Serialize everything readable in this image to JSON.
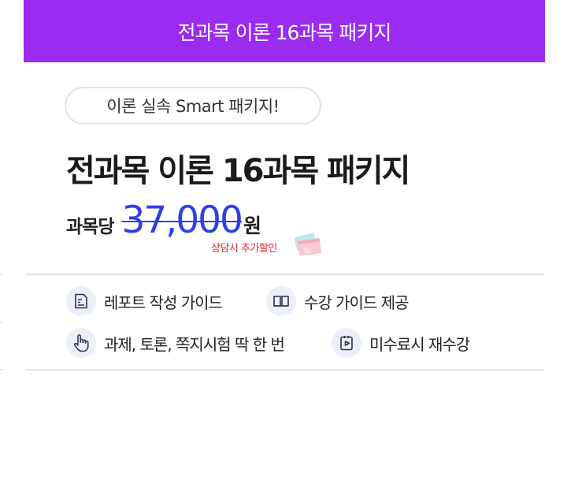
{
  "header": {
    "title": "전과목 이론 16과목 패키지"
  },
  "tagline": "이론 실속 Smart 패키지!",
  "product": {
    "title": "전과목 이론 16과목 패키지",
    "price_prefix": "과목당",
    "price": "37,000",
    "price_unit": "원",
    "discount_note": "상담시 추가할인"
  },
  "features": [
    {
      "icon": "report-icon",
      "label": "레포트 작성 가이드"
    },
    {
      "icon": "book-icon",
      "label": "수강 가이드 제공"
    },
    {
      "icon": "hand-pointer-icon",
      "label": "과제, 토론, 쪽지시험 딱 한 번"
    },
    {
      "icon": "video-icon",
      "label": "미수료시 재수강"
    }
  ],
  "colors": {
    "header_bg": "#9B2BF0",
    "price": "#2f3fe6",
    "discount": "#e0262f",
    "icon_circle": "#eceef8"
  }
}
